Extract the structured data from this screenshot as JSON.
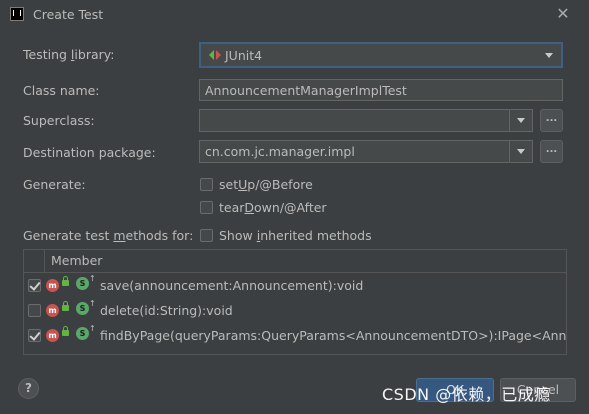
{
  "window": {
    "title": "Create Test",
    "close_icon": "close-icon"
  },
  "form": {
    "testing_library": {
      "label_pre": "Testing ",
      "label_ul": "l",
      "label_post": "ibrary:",
      "value": "JUnit4",
      "icon": "junit-icon"
    },
    "class_name": {
      "label": "Class name:",
      "value": "AnnouncementManagerImplTest"
    },
    "superclass": {
      "label": "Superclass:",
      "value": "",
      "browse_label": "..."
    },
    "destination_package": {
      "label": "Destination package:",
      "value": "cn.com.jc.manager.impl",
      "browse_label": "..."
    },
    "generate": {
      "label": "Generate:",
      "options": [
        {
          "pre": "set",
          "ul": "U",
          "post": "p/@Before",
          "checked": false
        },
        {
          "pre": "tear",
          "ul": "D",
          "post": "own/@After",
          "checked": false
        }
      ]
    },
    "methods_for": {
      "label_pre": "Generate test ",
      "label_ul": "m",
      "label_post": "ethods for:",
      "show_inherited": {
        "pre": "Show ",
        "ul": "i",
        "post": "nherited methods",
        "checked": false
      }
    }
  },
  "table": {
    "header": "Member",
    "rows": [
      {
        "checked": true,
        "signature": "save(announcement:Announcement):void"
      },
      {
        "checked": false,
        "signature": "delete(id:String):void"
      },
      {
        "checked": true,
        "signature": "findByPage(queryParams:QueryParams<AnnouncementDTO>):IPage<Announcen"
      }
    ]
  },
  "footer": {
    "help_label": "?",
    "ok_label": "OK",
    "cancel_label": "Cancel",
    "watermark": "CSDN @依赖，已成瘾"
  },
  "colors": {
    "background": "#3c3f41",
    "accent": "#365880",
    "focus_border": "#3d6185",
    "method_icon": "#c75450",
    "static_icon": "#59a869"
  }
}
